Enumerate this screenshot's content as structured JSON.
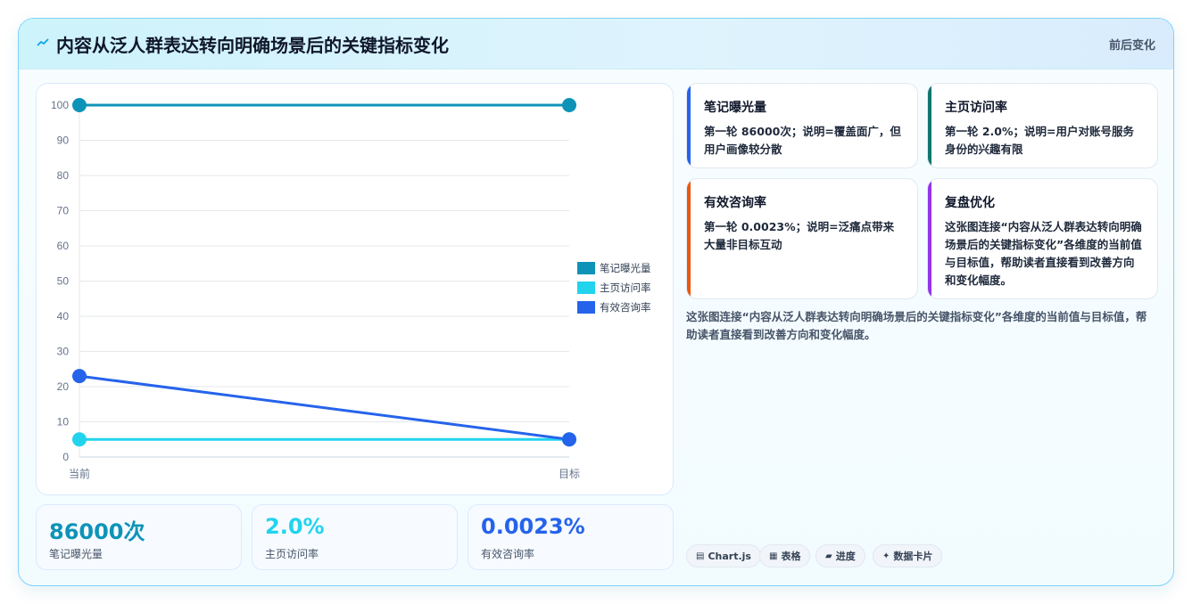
{
  "header": {
    "title": "内容从泛人群表达转向明确场景后的关键指标变化",
    "right_label": "前后变化"
  },
  "chart_data": {
    "type": "line",
    "categories": [
      "当前",
      "目标"
    ],
    "ylim": [
      0,
      100
    ],
    "yticks": [
      0,
      10,
      20,
      30,
      40,
      50,
      60,
      70,
      80,
      90,
      100
    ],
    "series": [
      {
        "name": "笔记曝光量",
        "values": [
          100,
          100
        ],
        "color": "#0e93b8"
      },
      {
        "name": "主页访问率",
        "values": [
          5,
          5
        ],
        "color": "#22d3ee"
      },
      {
        "name": "有效咨询率",
        "values": [
          23,
          5
        ],
        "color": "#2563eb"
      }
    ],
    "legend_position": "right",
    "grid": true
  },
  "kpis": [
    {
      "value": "86000次",
      "label": "笔记曝光量",
      "color": "#0e93b8"
    },
    {
      "value": "2.0%",
      "label": "主页访问率",
      "color": "#22d3ee"
    },
    {
      "value": "0.0023%",
      "label": "有效咨询率",
      "color": "#2563eb"
    }
  ],
  "cards": [
    {
      "title": "笔记曝光量",
      "text": "第一轮 86000次；说明=覆盖面广，但用户画像较分散",
      "color": "#2563eb"
    },
    {
      "title": "主页访问率",
      "text": "第一轮 2.0%；说明=用户对账号服务身份的兴趣有限",
      "color": "#0f766e"
    },
    {
      "title": "有效咨询率",
      "text": "第一轮 0.0023%；说明=泛痛点带来大量非目标互动",
      "color": "#ea580c"
    },
    {
      "title": "复盘优化",
      "text": "这张图连接“内容从泛人群表达转向明确场景后的关键指标变化”各维度的当前值与目标值，帮助读者直接看到改善方向和变化幅度。",
      "color": "#9333ea"
    }
  ],
  "description": "这张图连接“内容从泛人群表达转向明确场景后的关键指标变化”各维度的当前值与目标值，帮助读者直接看到改善方向和变化幅度。",
  "chips": [
    {
      "icon": "▤",
      "label": "Chart.js",
      "icon_name": "chart-icon"
    },
    {
      "icon": "▦",
      "label": "表格",
      "icon_name": "table-icon"
    },
    {
      "icon": "▰",
      "label": "进度",
      "icon_name": "progress-icon"
    },
    {
      "icon": "✦",
      "label": "数据卡片",
      "icon_name": "sparkle-icon"
    }
  ]
}
